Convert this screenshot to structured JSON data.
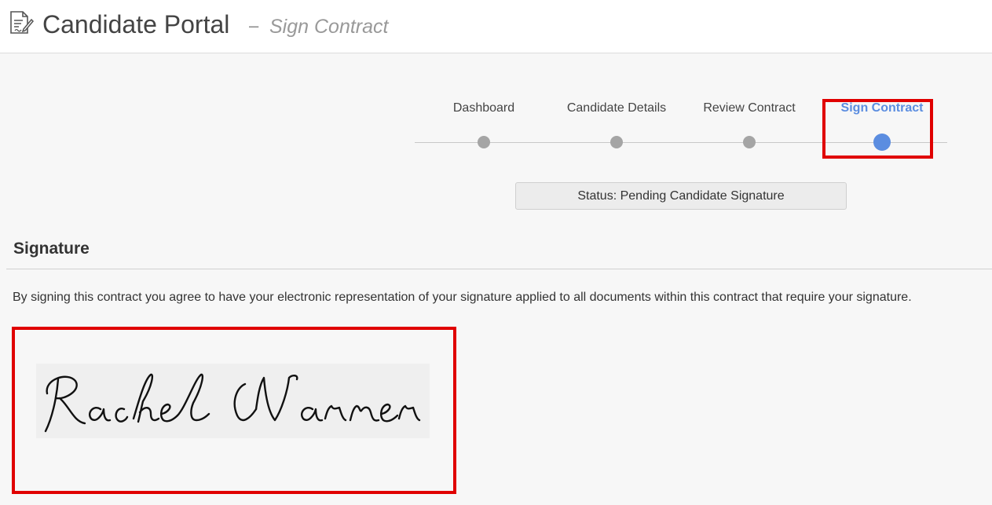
{
  "header": {
    "app_title": "Candidate Portal",
    "separator": "–",
    "page_subtitle": "Sign Contract",
    "icon": "document-edit-icon"
  },
  "stepper": {
    "steps": [
      {
        "label": "Dashboard",
        "state": "complete"
      },
      {
        "label": "Candidate Details",
        "state": "complete"
      },
      {
        "label": "Review Contract",
        "state": "complete"
      },
      {
        "label": "Sign Contract",
        "state": "active"
      }
    ],
    "inactive_color": "#a5a5a5",
    "active_color": "#5b8de0"
  },
  "status": {
    "text": "Status: Pending Candidate Signature"
  },
  "signature_section": {
    "title": "Signature",
    "consent": "By signing this contract you agree to have your electronic representation of your signature applied to all documents within this contract that require your signature.",
    "signature_name": "Rachel Warner"
  },
  "colors": {
    "highlight": "#e00000",
    "accent": "#5b8de0"
  }
}
